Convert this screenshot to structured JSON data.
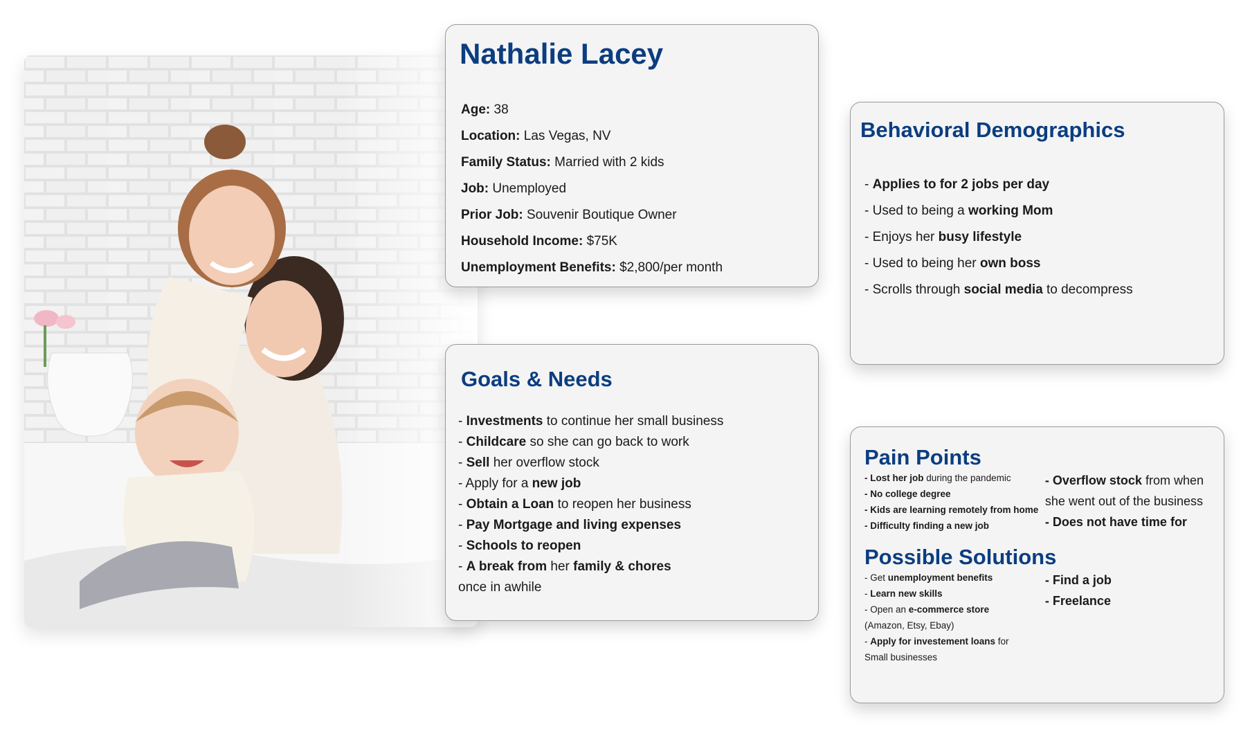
{
  "profile": {
    "name": "Nathalie Lacey",
    "rows": [
      {
        "label": "Age:",
        "value": " 38"
      },
      {
        "label": "Location:",
        "value": " Las Vegas, NV"
      },
      {
        "label": "Family Status:",
        "value": " Married with 2 kids"
      },
      {
        "label": "Job:",
        "value": " Unemployed"
      },
      {
        "label": "Prior Job:",
        "value": " Souvenir Boutique Owner"
      },
      {
        "label": "Household Income:",
        "value": " $75K"
      },
      {
        "label": "Unemployment Benefits:",
        "value": " $2,800/per month"
      }
    ]
  },
  "goals": {
    "title": "Goals & Needs",
    "items": [
      {
        "a": "- ",
        "b": "Investments",
        "c": " to continue her small business",
        "d": "",
        "e": ""
      },
      {
        "a": "- ",
        "b": "Childcare",
        "c": " so she can go back to work",
        "d": "",
        "e": ""
      },
      {
        "a": "- ",
        "b": "Sell",
        "c": " her overflow stock",
        "d": "",
        "e": ""
      },
      {
        "a": "- Apply for a ",
        "b": "new job",
        "c": "",
        "d": "",
        "e": ""
      },
      {
        "a": "- ",
        "b": "Obtain a Loan",
        "c": " to reopen her business",
        "d": "",
        "e": ""
      },
      {
        "a": "- ",
        "b": "Pay Mortgage and living expenses",
        "c": "",
        "d": "",
        "e": ""
      },
      {
        "a": "- ",
        "b": "Schools to reopen",
        "c": "",
        "d": "",
        "e": ""
      },
      {
        "a": "- ",
        "b": "A break from",
        "c": " her ",
        "d": "family & chores",
        "e": ""
      },
      {
        "a": "once in awhile",
        "b": "",
        "c": "",
        "d": "",
        "e": ""
      }
    ]
  },
  "behavioral": {
    "title": "Behavioral Demographics",
    "items": [
      {
        "a": "- ",
        "b": "Applies to for 2 jobs per day",
        "c": ""
      },
      {
        "a": "- Used to being a ",
        "b": "working Mom",
        "c": ""
      },
      {
        "a": "- Enjoys her ",
        "b": "busy lifestyle",
        "c": ""
      },
      {
        "a": "- Used to being her ",
        "b": "own boss",
        "c": ""
      },
      {
        "a": "- Scrolls through ",
        "b": "social media",
        "c": " to decompress"
      }
    ]
  },
  "pain": {
    "title": "Pain Points",
    "left": [
      {
        "b": "- Lost her job",
        "c": " during the pandemic"
      },
      {
        "b": "- No college degree",
        "c": ""
      },
      {
        "b": "- Kids are learning remotely from home",
        "c": ""
      },
      {
        "b": "- Difficulty finding a new job",
        "c": ""
      }
    ],
    "right": [
      {
        "b": "- Overflow stock",
        "c": " from when"
      },
      {
        "b": "",
        "c": "she went out of the business"
      },
      {
        "b": "- Does not have time for",
        "c": ""
      }
    ]
  },
  "solutions": {
    "title": "Possible Solutions",
    "left": [
      {
        "a": "- Get ",
        "b": "unemployment benefits",
        "c": ""
      },
      {
        "a": "- ",
        "b": "Learn new skills",
        "c": ""
      },
      {
        "a": "- Open an ",
        "b": "e-commerce store",
        "c": ""
      },
      {
        "a": "(Amazon, Etsy, Ebay)",
        "b": "",
        "c": ""
      },
      {
        "a": "- ",
        "b": "Apply for investement loans",
        "c": " for"
      },
      {
        "a": "Small businesses",
        "b": "",
        "c": ""
      }
    ],
    "right": [
      {
        "b": "- Find a job"
      },
      {
        "b": "- Freelance"
      }
    ]
  },
  "colors": {
    "heading": "#0b3d80",
    "card_bg": "#f4f4f4",
    "card_border": "#9a9a9a"
  }
}
